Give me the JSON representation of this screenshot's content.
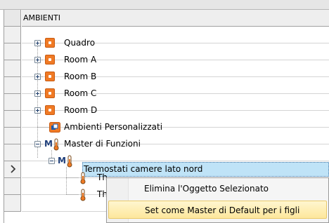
{
  "grid": {
    "header_label": "AMBIENTI",
    "current_row_indicator": "arrow-right-icon"
  },
  "tree": {
    "nodes": [
      {
        "label": "Quadro",
        "icon": "room-icon",
        "expander": "plus"
      },
      {
        "label": "Room A",
        "icon": "room-icon",
        "expander": "plus"
      },
      {
        "label": "Room B",
        "icon": "room-icon",
        "expander": "plus"
      },
      {
        "label": "Room C",
        "icon": "room-icon",
        "expander": "plus"
      },
      {
        "label": "Room D",
        "icon": "room-icon",
        "expander": "plus"
      },
      {
        "label": "Ambienti Personalizzati",
        "icon": "custom-rooms-icon",
        "expander": "none"
      },
      {
        "label": "Master di Funzioni",
        "icon": "function-master-icon",
        "expander": "minus"
      },
      {
        "label": "Termostati camere lato nord",
        "icon": "function-master-icon",
        "expander": "minus",
        "selected": true
      },
      {
        "label": "Th",
        "icon": "thermometer-icon",
        "expander": "none"
      },
      {
        "label": "Th",
        "icon": "thermometer-icon",
        "expander": "none"
      }
    ]
  },
  "context_menu": {
    "items": [
      {
        "label": "Elimina l'Oggetto Selezionato",
        "highlighted": false
      },
      {
        "label": "Set come Master di Default per i figli",
        "highlighted": true
      }
    ]
  },
  "colors": {
    "accent_orange": "#f07a25",
    "selection_blue": "#bfe3f7",
    "menu_highlight": "#fde79c"
  }
}
